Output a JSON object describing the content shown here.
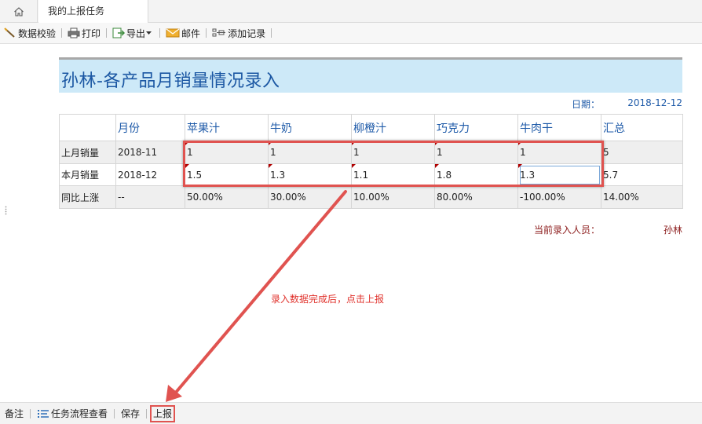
{
  "tabs": {
    "home_icon": "home-icon",
    "active_tab": "我的上报任务"
  },
  "toolbar": {
    "validate": "数据校验",
    "print": "打印",
    "export": "导出",
    "mail": "邮件",
    "add_record": "添加记录"
  },
  "report": {
    "title": "孙林-各产品月销量情况录入",
    "date_label": "日期：",
    "date_value": "2018-12-12",
    "headers": [
      "",
      "月份",
      "苹果汁",
      "牛奶",
      "柳橙汁",
      "巧克力",
      "牛肉干",
      "汇总"
    ],
    "rows": [
      {
        "label": "上月销量",
        "cells": [
          "2018-11",
          "1",
          "1",
          "1",
          "1",
          "1",
          "5"
        ]
      },
      {
        "label": "本月销量",
        "cells": [
          "2018-12",
          "1.5",
          "1.3",
          "1.1",
          "1.8",
          "1.3",
          "5.7"
        ]
      },
      {
        "label": "同比上涨",
        "cells": [
          "--",
          "50.00%",
          "30.00%",
          "10.00%",
          "80.00%",
          "-100.00%",
          "14.00%"
        ]
      }
    ],
    "entry_label": "当前录入人员：",
    "entry_value": "孙林"
  },
  "annotation": {
    "text": "录入数据完成后，点击上报",
    "color": "#e05350"
  },
  "bottombar": {
    "note": "备注",
    "flow": "任务流程查看",
    "save": "保存",
    "submit": "上报"
  }
}
